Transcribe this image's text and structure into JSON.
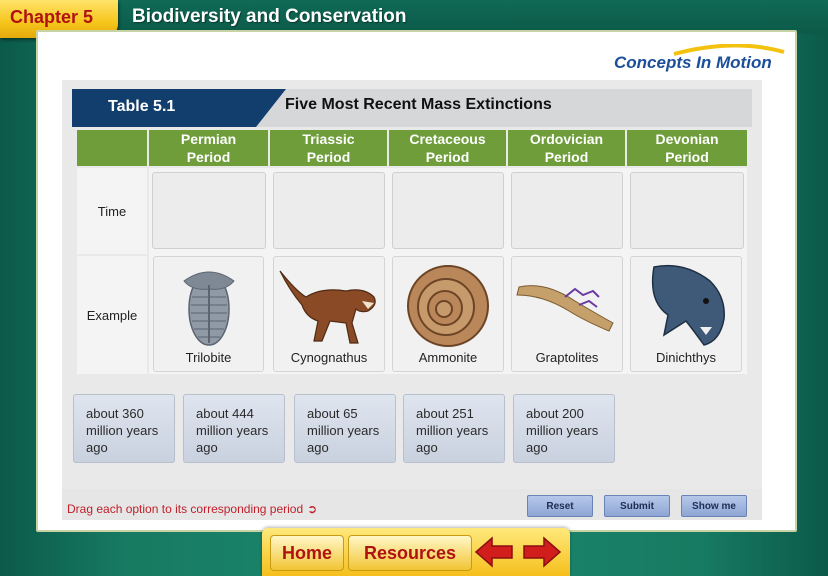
{
  "header": {
    "chapter": "Chapter 5",
    "title": "Biodiversity and Conservation"
  },
  "logo": {
    "text": "Concepts In Motion"
  },
  "table": {
    "label": "Table 5.1",
    "title": "Five Most Recent Mass Extinctions",
    "columns": [
      {
        "line1": "Permian",
        "line2": "Period"
      },
      {
        "line1": "Triassic",
        "line2": "Period"
      },
      {
        "line1": "Cretaceous",
        "line2": "Period"
      },
      {
        "line1": "Ordovician",
        "line2": "Period"
      },
      {
        "line1": "Devonian",
        "line2": "Period"
      }
    ],
    "rows": {
      "time": "Time",
      "example": "Example"
    },
    "examples": [
      "Trilobite",
      "Cynognathus",
      "Ammonite",
      "Graptolites",
      "Dinichthys"
    ]
  },
  "options": [
    "about 360 million years ago",
    "about 444 million years ago",
    "about 65 million years ago",
    "about 251 million years ago",
    "about 200 million years ago"
  ],
  "instruction": "Drag each option to its corresponding period",
  "buttons": {
    "reset": "Reset",
    "submit": "Submit",
    "show_me": "Show me"
  },
  "nav": {
    "home": "Home",
    "resources": "Resources"
  },
  "colors": {
    "header_green": "#6e9d3a",
    "table_label_blue": "#123e6e",
    "chapter_red": "#b01212",
    "instruction_red": "#c0202a"
  }
}
